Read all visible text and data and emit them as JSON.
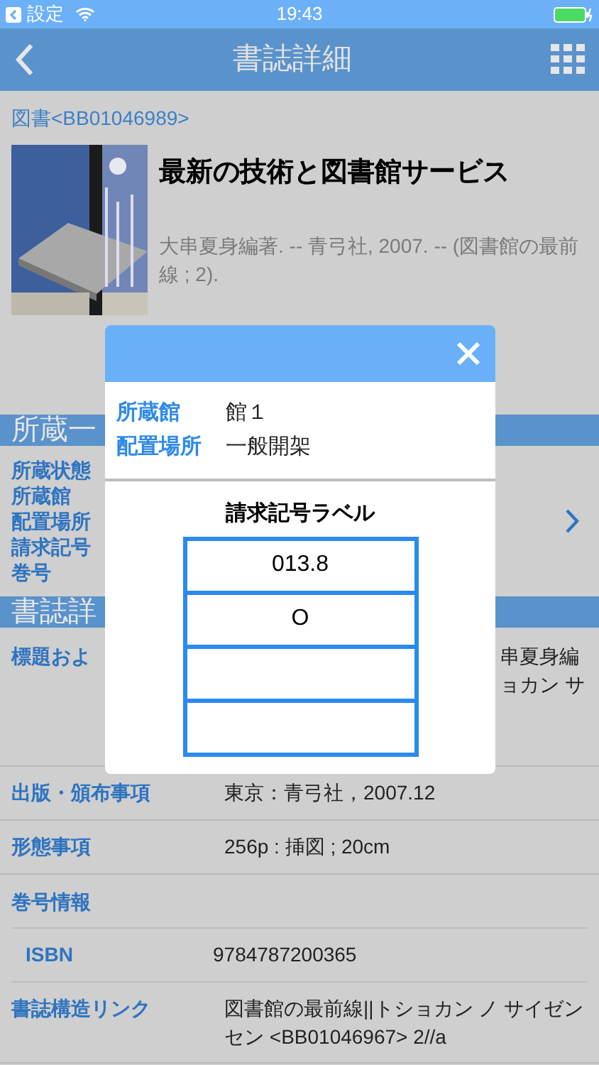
{
  "status_bar": {
    "back_app": "設定",
    "time": "19:43"
  },
  "nav": {
    "title": "書誌詳細"
  },
  "record": {
    "id_link": "図書<BB01046989>",
    "title": "最新の技術と図書館サービス",
    "description": "大串夏身編著. -- 青弓社, 2007. -- (図書館の最前線 ; 2)."
  },
  "holdings": {
    "heading": "所蔵一",
    "labels": [
      "所蔵状態",
      "所蔵館",
      "配置場所",
      "請求記号",
      "巻号"
    ]
  },
  "bib": {
    "heading": "書誌詳",
    "title_row": {
      "label": "標題およ",
      "value_lines": [
        "串夏身編",
        "ョカン サ"
      ]
    },
    "rows": [
      {
        "kind": "field",
        "label": "出版・頒布事項",
        "value": "東京：青弓社，2007.12"
      },
      {
        "kind": "field",
        "label": "形態事項",
        "value": "256p : 挿図 ; 20cm"
      },
      {
        "kind": "group",
        "label": "巻号情報"
      },
      {
        "kind": "subfield",
        "label": "ISBN",
        "value": "9784787200365"
      },
      {
        "kind": "field",
        "label": "書誌構造リンク",
        "value": "図書館の最前線||トショカン ノ サイゼンセン <BB01046967> 2//a"
      }
    ]
  },
  "modal": {
    "fields": [
      {
        "label": "所蔵館",
        "value": "館１"
      },
      {
        "label": "配置場所",
        "value": "一般開架"
      }
    ],
    "label_title": "請求記号ラベル",
    "label_cells": [
      "013.8",
      "O",
      "",
      ""
    ]
  }
}
